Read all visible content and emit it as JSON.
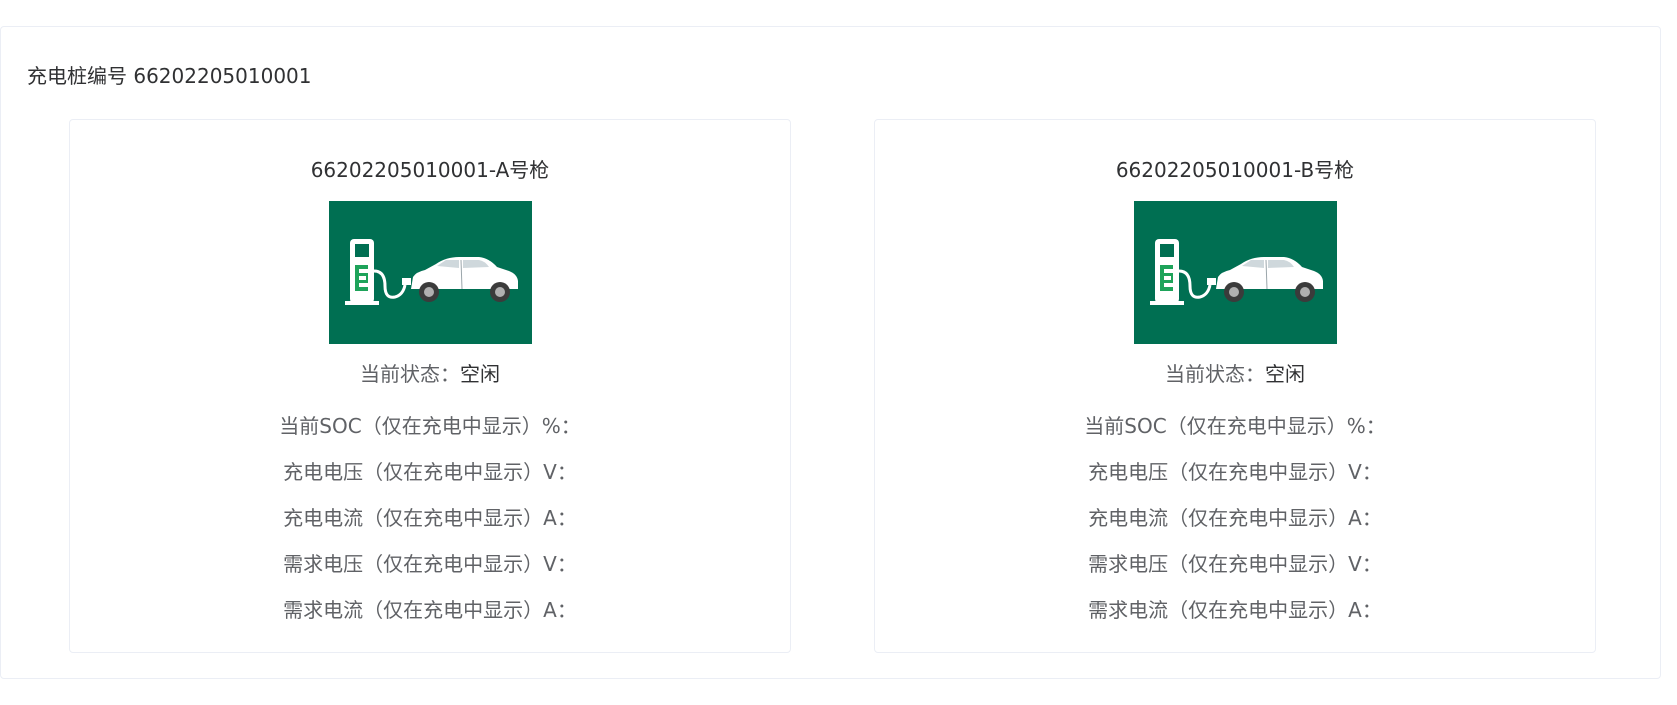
{
  "pile": {
    "title": "充电桩编号 66202205010001"
  },
  "guns": [
    {
      "name": "66202205010001-A号枪",
      "image_icon": "ev-charging-car-icon",
      "status_label": "当前状态：",
      "status_value": "空闲",
      "metrics": [
        "当前SOC（仅在充电中显示）%：",
        "充电电压（仅在充电中显示）V：",
        "充电电流（仅在充电中显示）A：",
        "需求电压（仅在充电中显示）V：",
        "需求电流（仅在充电中显示）A："
      ]
    },
    {
      "name": "66202205010001-B号枪",
      "image_icon": "ev-charging-car-icon",
      "status_label": "当前状态：",
      "status_value": "空闲",
      "metrics": [
        "当前SOC（仅在充电中显示）%：",
        "充电电压（仅在充电中显示）V：",
        "充电电流（仅在充电中显示）A：",
        "需求电压（仅在充电中显示）V：",
        "需求电流（仅在充电中显示）A："
      ]
    }
  ],
  "colors": {
    "image_background": "#006f52",
    "station_letter": "#1ea35a",
    "border": "#ebeef5"
  }
}
